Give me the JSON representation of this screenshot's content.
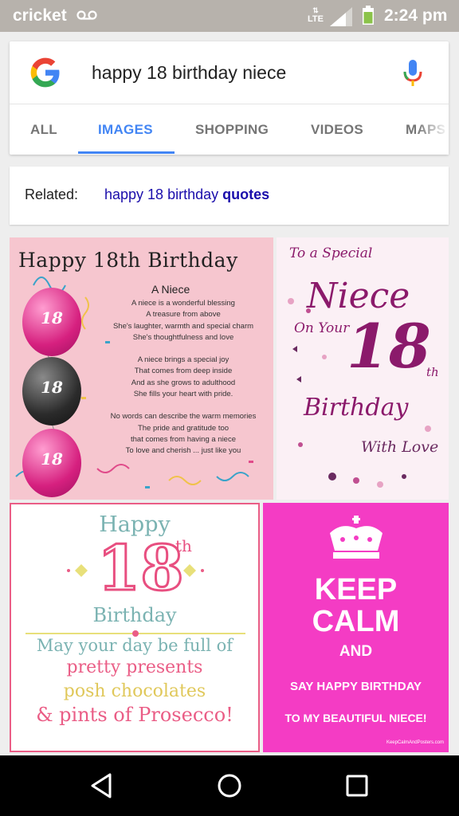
{
  "status_bar": {
    "carrier": "cricket",
    "network": "LTE",
    "time": "2:24 pm",
    "icons": [
      "voicemail-icon",
      "lte-icon",
      "signal-icon",
      "battery-icon"
    ],
    "battery_color": "#8bc34a"
  },
  "search": {
    "query": "happy 18 birthday niece",
    "logo": "google-logo",
    "mic_icon": "mic-icon"
  },
  "tabs": [
    {
      "label": "ALL",
      "active": false
    },
    {
      "label": "IMAGES",
      "active": true
    },
    {
      "label": "SHOPPING",
      "active": false
    },
    {
      "label": "VIDEOS",
      "active": false
    },
    {
      "label": "MAPS",
      "active": false
    }
  ],
  "related": {
    "label": "Related:",
    "link_prefix": "happy 18 birthday",
    "link_bold": "quotes"
  },
  "results": {
    "card1": {
      "title": "Happy 18th Birthday",
      "subtitle": "A Niece",
      "balloon_number": "18",
      "poem": [
        "A niece is a wonderful blessing",
        "A treasure from above",
        "She's laughter, warmth and special charm",
        "She's thoughtfulness and love",
        "",
        "A niece brings a special joy",
        "That comes from deep inside",
        "And as she grows to adulthood",
        "She fills your heart with pride.",
        "",
        "No words can describe the warm memories",
        "The pride and gratitude too",
        "that comes from having a niece",
        "To love and cherish ... just like you"
      ]
    },
    "card2": {
      "line1": "To a Special",
      "line2": "Niece",
      "line3": "On Your",
      "number": "18",
      "suffix": "th",
      "line4": "Birthday",
      "line5": "With Love"
    },
    "card3": {
      "happy": "Happy",
      "number": "18",
      "suffix": "th",
      "birthday": "Birthday",
      "line1": "May your day be full of",
      "line2": "pretty presents",
      "line3": "posh chocolates",
      "line4": "& pints of Prosecco!"
    },
    "card4": {
      "line1": "KEEP",
      "line2": "CALM",
      "line3": "AND",
      "line4": "SAY HAPPY BIRTHDAY",
      "line5": "TO MY BEAUTIFUL NIECE!",
      "watermark": "KeepCalmAndPosters.com"
    }
  },
  "nav_bar": {
    "buttons": [
      "back-icon",
      "home-icon",
      "recents-icon"
    ]
  }
}
